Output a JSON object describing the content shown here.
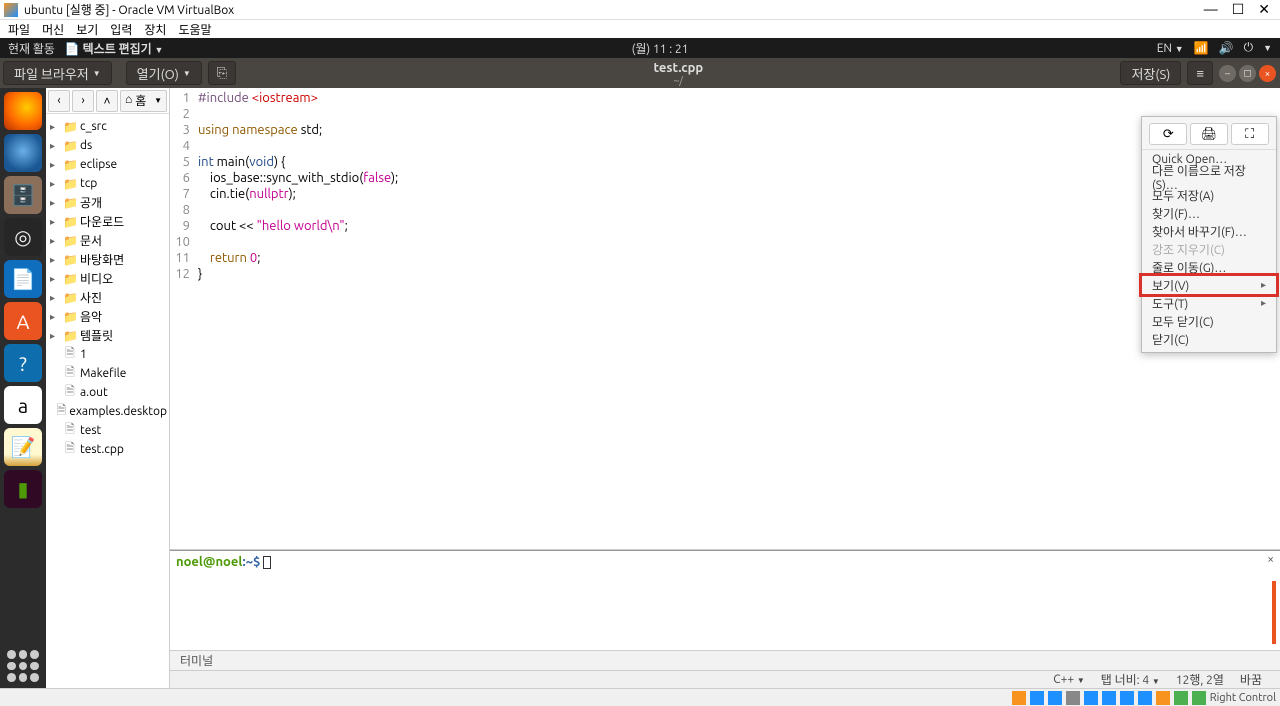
{
  "win": {
    "title": "ubuntu [실행 중] - Oracle VM VirtualBox"
  },
  "vb_menu": [
    "파일",
    "머신",
    "보기",
    "입력",
    "장치",
    "도움말"
  ],
  "gnome": {
    "activities": "현재 활동",
    "app": "텍스트 편집기",
    "clock": "(월)  11 : 21",
    "lang": "EN"
  },
  "gedit": {
    "browser_btn": "파일 브라우저",
    "open_btn": "열기(O)",
    "filename": "test.cpp",
    "subtitle": "~/",
    "save_btn": "저장(S)"
  },
  "fbrowser": {
    "home": "홈",
    "tree": [
      {
        "type": "folder",
        "name": "c_src",
        "open": false
      },
      {
        "type": "folder",
        "name": "ds",
        "open": false
      },
      {
        "type": "folder",
        "name": "eclipse",
        "open": false
      },
      {
        "type": "folder",
        "name": "tcp",
        "open": false
      },
      {
        "type": "folder",
        "name": "공개",
        "open": false
      },
      {
        "type": "folder",
        "name": "다운로드",
        "open": false
      },
      {
        "type": "folder",
        "name": "문서",
        "open": false
      },
      {
        "type": "folder",
        "name": "바탕화면",
        "open": false,
        "iconColor": "#6a4fa0"
      },
      {
        "type": "folder",
        "name": "비디오",
        "open": false,
        "iconColor": "#6a4fa0"
      },
      {
        "type": "folder",
        "name": "사진",
        "open": false,
        "iconColor": "#6a4fa0"
      },
      {
        "type": "folder",
        "name": "음악",
        "open": false,
        "iconColor": "#6a4fa0"
      },
      {
        "type": "folder",
        "name": "템플릿",
        "open": false
      },
      {
        "type": "file",
        "name": "1"
      },
      {
        "type": "file",
        "name": "Makefile"
      },
      {
        "type": "file",
        "name": "a.out"
      },
      {
        "type": "file",
        "name": "examples.desktop"
      },
      {
        "type": "file",
        "name": "test"
      },
      {
        "type": "file",
        "name": "test.cpp"
      }
    ]
  },
  "code": {
    "lines": [
      [
        {
          "c": "k-pre",
          "t": "#include "
        },
        {
          "c": "k-inc",
          "t": "<iostream>"
        }
      ],
      [],
      [
        {
          "c": "k-kw",
          "t": "using namespace"
        },
        {
          "c": "",
          "t": " std;"
        }
      ],
      [],
      [
        {
          "c": "k-type",
          "t": "int"
        },
        {
          "c": "",
          "t": " main("
        },
        {
          "c": "k-type",
          "t": "void"
        },
        {
          "c": "",
          "t": ") {"
        }
      ],
      [
        {
          "c": "",
          "t": "    ios_base::sync_with_stdio("
        },
        {
          "c": "k-const",
          "t": "false"
        },
        {
          "c": "",
          "t": ");"
        }
      ],
      [
        {
          "c": "",
          "t": "    cin.tie("
        },
        {
          "c": "k-const",
          "t": "nullptr"
        },
        {
          "c": "",
          "t": ");"
        }
      ],
      [],
      [
        {
          "c": "",
          "t": "    cout << "
        },
        {
          "c": "k-str",
          "t": "\"hello world\\n\""
        },
        {
          "c": "",
          "t": ";"
        }
      ],
      [],
      [
        {
          "c": "",
          "t": "    "
        },
        {
          "c": "k-kw",
          "t": "return"
        },
        {
          "c": "",
          "t": " "
        },
        {
          "c": "k-num",
          "t": "0"
        },
        {
          "c": "",
          "t": ";"
        }
      ],
      [
        {
          "c": "",
          "t": "}"
        }
      ]
    ]
  },
  "terminal": {
    "user": "noel",
    "host": "noel",
    "prompt": ":~$ ",
    "tab": "터미널"
  },
  "menu": {
    "quick_open": "Quick Open…",
    "save_as": "다른 이름으로 저장(S)…",
    "save_all": "모두 저장(A)",
    "find": "찾기(F)…",
    "replace": "찾아서 바꾸기(F)…",
    "clear_highlight": "강조 지우기(C)",
    "goto": "줄로 이동(G)…",
    "view": "보기(V)",
    "tools": "도구(T)",
    "close_all": "모두 닫기(C)",
    "close": "닫기(C)"
  },
  "status": {
    "lang": "C++",
    "tab": "탭 너비: 4",
    "pos": "12행, 2열",
    "ins": "바꿈"
  },
  "vb_status": {
    "right_ctrl": "Right Control"
  }
}
